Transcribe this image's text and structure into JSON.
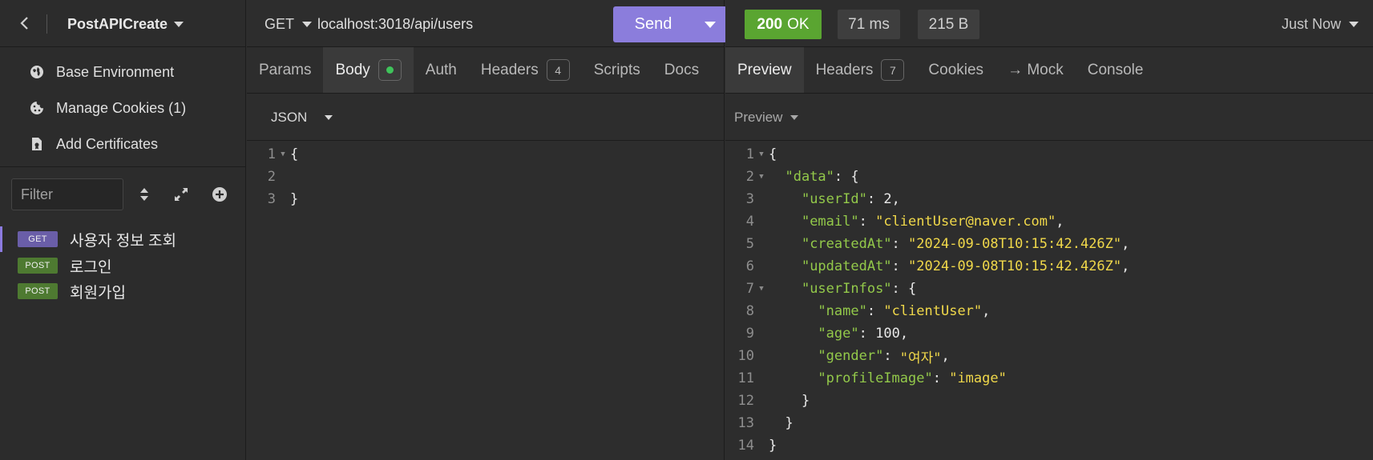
{
  "sidebar": {
    "project_name": "PostAPICreate",
    "menu": [
      {
        "label": "Base Environment",
        "icon": "globe-icon"
      },
      {
        "label": "Manage Cookies (1)",
        "icon": "cookie-icon"
      },
      {
        "label": "Add Certificates",
        "icon": "certificate-icon"
      }
    ],
    "filter_placeholder": "Filter",
    "requests": [
      {
        "method": "GET",
        "name": "사용자 정보 조회",
        "active": true
      },
      {
        "method": "POST",
        "name": "로그인",
        "active": false
      },
      {
        "method": "POST",
        "name": "회원가입",
        "active": false
      }
    ]
  },
  "request": {
    "method": "GET",
    "url": "localhost:3018/api/users",
    "send_label": "Send",
    "tabs": {
      "params": "Params",
      "body": "Body",
      "auth": "Auth",
      "headers": "Headers",
      "headers_count": "4",
      "scripts": "Scripts",
      "docs": "Docs"
    },
    "body_type": "JSON",
    "body_lines": [
      {
        "n": "1",
        "text": "{"
      },
      {
        "n": "2",
        "text": ""
      },
      {
        "n": "3",
        "text": "}"
      }
    ]
  },
  "response": {
    "status_code": "200",
    "status_text": "OK",
    "time": "71 ms",
    "size": "215 B",
    "history": "Just Now",
    "tabs": {
      "preview": "Preview",
      "headers": "Headers",
      "headers_count": "7",
      "cookies": "Cookies",
      "mock": "→ Mock",
      "console": "Console"
    },
    "preview_mode": "Preview",
    "line_numbers": [
      "1",
      "2",
      "3",
      "4",
      "5",
      "6",
      "7",
      "8",
      "9",
      "10",
      "11",
      "12",
      "13",
      "14"
    ],
    "json": {
      "userId_key": "\"userId\"",
      "userId_val": "2",
      "email_key": "\"email\"",
      "email_val": "\"clientUser@naver.com\"",
      "createdAt_key": "\"createdAt\"",
      "createdAt_val": "\"2024-09-08T10:15:42.426Z\"",
      "updatedAt_key": "\"updatedAt\"",
      "updatedAt_val": "\"2024-09-08T10:15:42.426Z\"",
      "userInfos_key": "\"userInfos\"",
      "name_key": "\"name\"",
      "name_val": "\"clientUser\"",
      "age_key": "\"age\"",
      "age_val": "100",
      "gender_key": "\"gender\"",
      "gender_val": "\"여자\"",
      "profileImage_key": "\"profileImage\"",
      "profileImage_val": "\"image\"",
      "data_key": "\"data\""
    }
  }
}
